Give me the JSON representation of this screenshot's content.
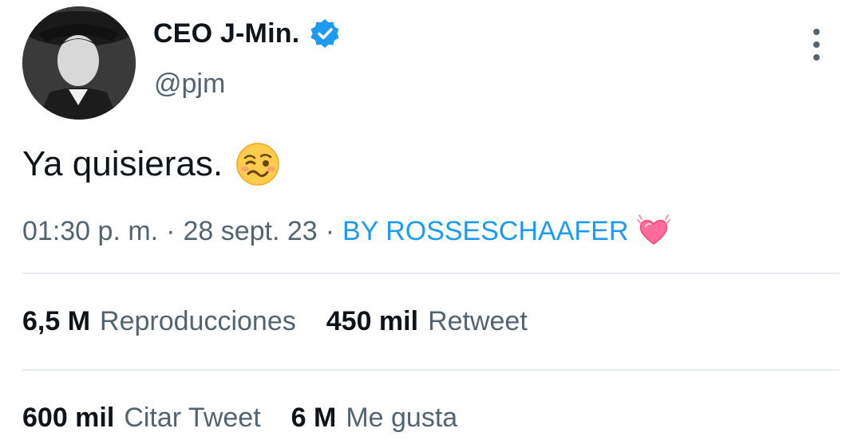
{
  "user": {
    "display_name": "CEO J-Min.",
    "handle": "@pjm"
  },
  "tweet": {
    "text": "Ya quisieras.",
    "emoji": "woozy-face"
  },
  "meta": {
    "time": "01:30 p. m.",
    "separator": "·",
    "date": "28 sept. 23",
    "source": "BY ROSSESCHAAFER",
    "source_emoji": "growing-heart"
  },
  "stats": {
    "views_count": "6,5 M",
    "views_label": "Reproducciones",
    "retweets_count": "450 mil",
    "retweets_label": "Retweet",
    "quotes_count": "600 mil",
    "quotes_label": "Citar Tweet",
    "likes_count": "6 M",
    "likes_label": "Me gusta"
  },
  "colors": {
    "text": "#0f1419",
    "secondary": "#536471",
    "accent": "#1d9bf0",
    "divider": "#e6ecf0"
  }
}
